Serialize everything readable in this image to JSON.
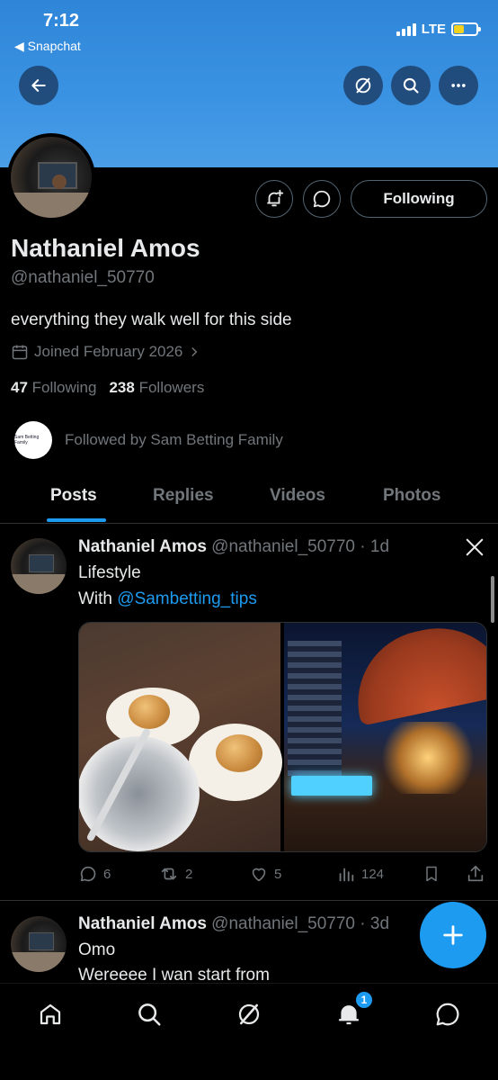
{
  "status_bar": {
    "time": "7:12",
    "back_app": "Snapchat",
    "network": "LTE"
  },
  "profile": {
    "name": "Nathaniel Amos",
    "handle": "@nathaniel_50770",
    "bio": "everything they walk well for this side",
    "joined": "Joined February 2026",
    "following_count": "47",
    "following_label": "Following",
    "followers_count": "238",
    "followers_label": "Followers",
    "followed_by": "Followed by Sam Betting Family",
    "followed_by_avatar_text": "Sam Betting Family",
    "follow_button": "Following"
  },
  "tabs": [
    "Posts",
    "Replies",
    "Videos",
    "Photos"
  ],
  "active_tab": "Posts",
  "posts": [
    {
      "author": "Nathaniel Amos",
      "handle": "@nathaniel_50770",
      "time": "· 1d",
      "line1": "Lifestyle",
      "line2_prefix": "With ",
      "mention": "@Sambetting_tips",
      "replies": "6",
      "reposts": "2",
      "likes": "5",
      "views": "124"
    },
    {
      "author": "Nathaniel Amos",
      "handle": "@nathaniel_50770",
      "time": "· 3d",
      "line1": "Omo",
      "line2": "Wereeee I wan start from"
    }
  ],
  "notifications_badge": "1",
  "colors": {
    "accent": "#1d9bf0",
    "banner": "#3b93e3",
    "muted": "#71767b",
    "text": "#e7e9ea"
  }
}
